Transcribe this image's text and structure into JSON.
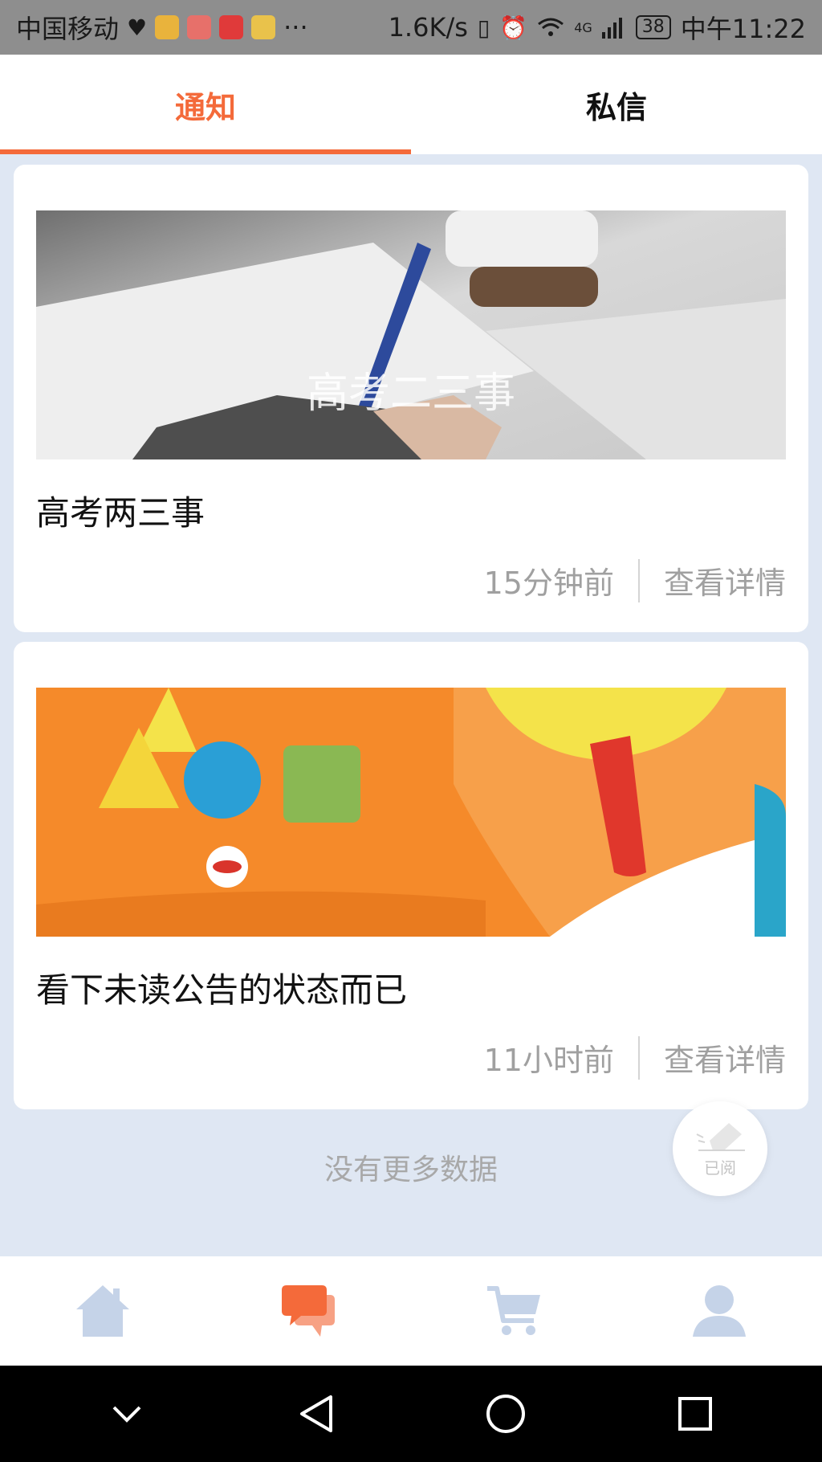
{
  "status_bar": {
    "carrier": "中国移动",
    "more": "···",
    "speed": "1.6K/s",
    "network": "4G",
    "battery": "38",
    "time": "中午11:22"
  },
  "tabs": [
    {
      "label": "通知",
      "active": true
    },
    {
      "label": "私信",
      "active": false
    }
  ],
  "notices": [
    {
      "title": "高考两三事",
      "time": "15分钟前",
      "action": "查看详情",
      "image_caption": "高考二三事"
    },
    {
      "title": "看下未读公告的状态而已",
      "time": "11小时前",
      "action": "查看详情"
    }
  ],
  "no_more": "没有更多数据",
  "read_button": {
    "label": "已阅"
  },
  "bottom_nav": [
    {
      "icon": "home-icon",
      "active": false
    },
    {
      "icon": "chat-icon",
      "active": true
    },
    {
      "icon": "cart-icon",
      "active": false
    },
    {
      "icon": "user-icon",
      "active": false
    }
  ],
  "colors": {
    "accent": "#f46a3a",
    "nav_inactive": "#c5d3e8",
    "background": "#dfe7f3"
  }
}
